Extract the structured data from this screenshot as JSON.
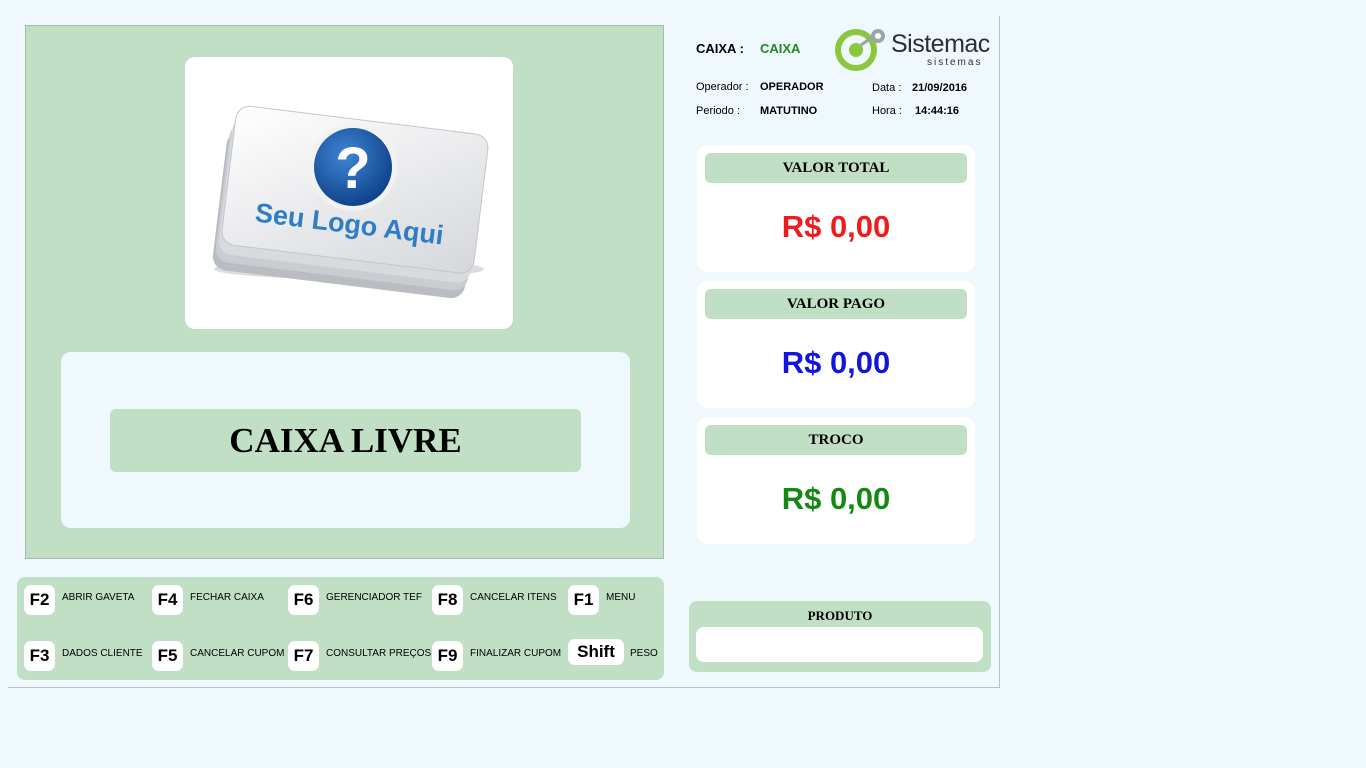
{
  "header": {
    "caixa_label": "CAIXA :",
    "caixa_value": "CAIXA",
    "operador_label": "Operador :",
    "operador_value": "OPERADOR",
    "periodo_label": "Periodo :",
    "periodo_value": "MATUTINO",
    "data_label": "Data :",
    "data_value": "21/09/2016",
    "hora_label": "Hora :",
    "hora_value": "14:44:16"
  },
  "brand": {
    "name": "Sistemac",
    "sub": "sistemas",
    "accent": "#8cc63f",
    "gray": "#9aa5a8"
  },
  "logo": {
    "text": "Seu Logo Aqui",
    "symbol": "?",
    "icon": "question-logo-placeholder"
  },
  "status": {
    "text": "CAIXA LIVRE"
  },
  "values": [
    {
      "title": "VALOR TOTAL",
      "amount": "R$ 0,00",
      "color": "#ee1c1c"
    },
    {
      "title": "VALOR PAGO",
      "amount": "R$ 0,00",
      "color": "#1414e0"
    },
    {
      "title": "TROCO",
      "amount": "R$ 0,00",
      "color": "#138913"
    }
  ],
  "shortcuts": [
    {
      "key": "F2",
      "label": "ABRIR GAVETA"
    },
    {
      "key": "F4",
      "label": "FECHAR CAIXA"
    },
    {
      "key": "F6",
      "label": "GERENCIADOR TEF"
    },
    {
      "key": "F8",
      "label": "CANCELAR ITENS"
    },
    {
      "key": "F1",
      "label": "MENU"
    },
    {
      "key": "F3",
      "label": "DADOS CLIENTE"
    },
    {
      "key": "F5",
      "label": "CANCELAR CUPOM"
    },
    {
      "key": "F7",
      "label": "CONSULTAR PREÇOS"
    },
    {
      "key": "F9",
      "label": "FINALIZAR CUPOM"
    },
    {
      "key": "Shift",
      "label": "PESO"
    }
  ],
  "produto": {
    "title": "PRODUTO",
    "value": ""
  },
  "colors": {
    "panel_green": "#c1dfc5",
    "background": "#eff9fd"
  }
}
